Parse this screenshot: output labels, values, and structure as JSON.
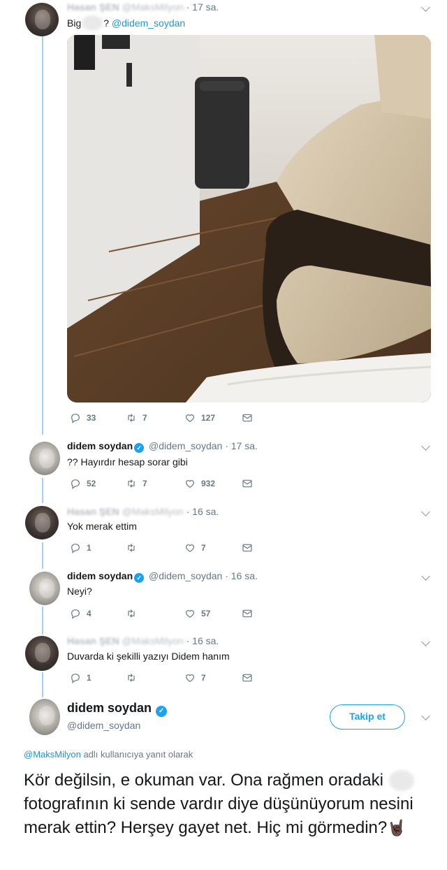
{
  "tweets": [
    {
      "author_name": "Hasan ŞEN",
      "author_handle": "@MaksMilyon",
      "time": "17 sa.",
      "text_pre": "Big",
      "text_post": "?",
      "mention": "@didem_soydan",
      "replies": "33",
      "retweets": "7",
      "likes": "127"
    },
    {
      "author_name": "didem soydan",
      "author_handle": "@didem_soydan",
      "time": "17 sa.",
      "text": "?? Hayırdır hesap sorar gibi",
      "replies": "52",
      "retweets": "7",
      "likes": "932"
    },
    {
      "author_name": "Hasan ŞEN",
      "author_handle": "@MaksMilyon",
      "time": "16 sa.",
      "text": "Yok merak ettim",
      "replies": "1",
      "retweets": "",
      "likes": "7"
    },
    {
      "author_name": "didem soydan",
      "author_handle": "@didem_soydan",
      "time": "16 sa.",
      "text": "Neyi?",
      "replies": "4",
      "retweets": "",
      "likes": "57"
    },
    {
      "author_name": "Hasan ŞEN",
      "author_handle": "@MaksMilyon",
      "time": "16 sa.",
      "text": "Duvarda ki şekilli yazıyı Didem hanım",
      "replies": "1",
      "retweets": "",
      "likes": "7"
    }
  ],
  "main": {
    "author_name": "didem soydan",
    "author_handle": "@didem_soydan",
    "follow_label": "Takip et",
    "reply_mention": "@MaksMilyon",
    "reply_suffix": " adlı kullanıcıya yanıt olarak",
    "text_part1": "Kör değilsin, e okuman var. Ona rağmen oradaki",
    "text_part2": "fotografının ki sende vardır diye düşünüyorum nesini merak ettin? Herşey gayet net. Hiç mi görmedin?",
    "emoji": "🤘🏿"
  },
  "colors": {
    "accent": "#1da1f2",
    "link": "#1b95e0",
    "thread_line": "#9ed3f5",
    "muted_text": "#657786"
  },
  "icons": [
    "reply-icon",
    "retweet-icon",
    "like-icon",
    "direct-message-icon",
    "chevron-down-icon",
    "verified-badge-icon"
  ]
}
